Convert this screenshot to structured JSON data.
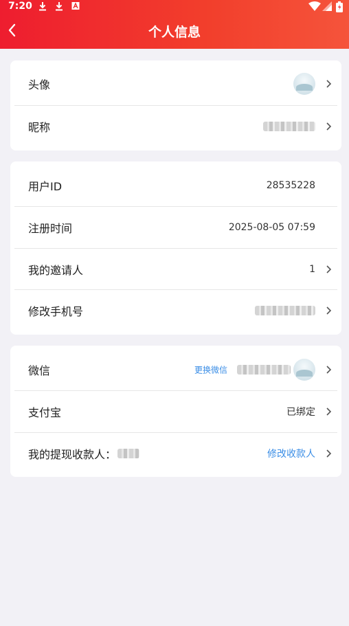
{
  "status_bar": {
    "time": "7:20",
    "icons": [
      "download-icon",
      "download-icon",
      "font-icon",
      "wifi-icon",
      "signal-icon",
      "battery-icon"
    ]
  },
  "header": {
    "title": "个人信息",
    "back_icon": "chevron-left-icon"
  },
  "card1": {
    "avatar_label": "头像",
    "nickname_label": "昵称"
  },
  "card2": {
    "user_id_label": "用户ID",
    "user_id_value": "28535228",
    "register_time_label": "注册时间",
    "register_time_value": "2025-08-05 07:59",
    "inviter_label": "我的邀请人",
    "inviter_value": "1",
    "phone_label": "修改手机号"
  },
  "card3": {
    "wechat_label": "微信",
    "wechat_change": "更换微信",
    "alipay_label": "支付宝",
    "alipay_value": "已绑定",
    "payee_label": "我的提现收款人：",
    "payee_action": "修改收款人"
  },
  "colors": {
    "header_gradient_start": "#ee1d2f",
    "header_gradient_end": "#f5543b",
    "link_blue": "#3b8ee6",
    "page_bg": "#f2f1f6"
  }
}
